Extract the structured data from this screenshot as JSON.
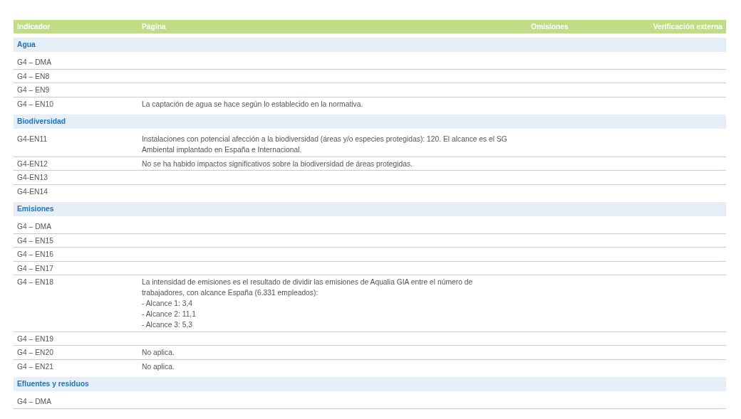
{
  "table": {
    "columns": [
      "Indicador",
      "Página",
      "Omisiones",
      "Verificación externa"
    ],
    "sections": [
      {
        "title": "Agua",
        "rows": [
          {
            "indicator": "G4 – DMA"
          },
          {
            "indicator": "G4 – EN8"
          },
          {
            "indicator": "G4 – EN9"
          },
          {
            "indicator": "G4 – EN10",
            "page": "La captación de agua se hace según lo establecido en la normativa."
          }
        ]
      },
      {
        "title": "Biodiversidad",
        "rows": [
          {
            "indicator": "G4-EN11",
            "page": "Instalaciones con potencial afección a la biodiversidad (áreas y/o especies protegidas): 120. El alcance es el SG\nAmbiental implantado en España e Internacional."
          },
          {
            "indicator": "G4-EN12",
            "page": "No se ha habido impactos significativos sobre la biodiversidad de áreas protegidas."
          },
          {
            "indicator": "G4-EN13"
          },
          {
            "indicator": "G4-EN14"
          }
        ]
      },
      {
        "title": "Emisiones",
        "rows": [
          {
            "indicator": "G4 – DMA"
          },
          {
            "indicator": "G4 – EN15"
          },
          {
            "indicator": "G4 – EN16"
          },
          {
            "indicator": "G4 – EN17"
          },
          {
            "indicator": "G4 – EN18",
            "page": "La intensidad de emisiones es el resultado de dividir las emisiones de Aqualia GIA entre el número de\ntrabajadores, con alcance España (6.331 empleados):\n- Alcance 1: 3,4\n- Alcance 2: 11,1\n- Alcance 3: 5,3"
          },
          {
            "indicator": "G4 – EN19"
          },
          {
            "indicator": "G4 – EN20",
            "page": "No aplica."
          },
          {
            "indicator": "G4 – EN21",
            "page": "No aplica."
          }
        ]
      },
      {
        "title": "Efluentes y residuos",
        "rows": [
          {
            "indicator": "G4 – DMA"
          }
        ]
      }
    ]
  }
}
